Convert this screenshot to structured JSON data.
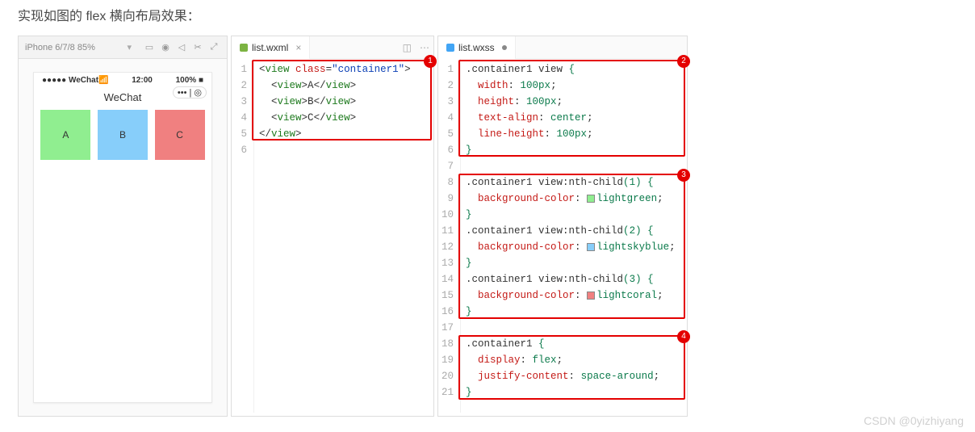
{
  "title": "实现如图的 flex 横向布局效果：",
  "watermark": "CSDN @0yizhiyang",
  "simulator": {
    "device": "iPhone 6/7/8 85%",
    "carrier": "WeChat",
    "time": "12:00",
    "battery": "100%",
    "appTitle": "WeChat",
    "boxes": [
      "A",
      "B",
      "C"
    ]
  },
  "wxml": {
    "filename": "list.wxml",
    "lines": [
      {
        "n": "1",
        "parts": [
          {
            "t": "<",
            "c": "tag"
          },
          {
            "t": "view",
            "c": "tn"
          },
          {
            "t": " ",
            "c": "tag"
          },
          {
            "t": "class",
            "c": "attr"
          },
          {
            "t": "=",
            "c": "tag"
          },
          {
            "t": "\"container1\"",
            "c": "val"
          },
          {
            "t": ">",
            "c": "tag"
          }
        ]
      },
      {
        "n": "2",
        "parts": [
          {
            "t": "  <",
            "c": "tag"
          },
          {
            "t": "view",
            "c": "tn"
          },
          {
            "t": ">",
            "c": "tag"
          },
          {
            "t": "A",
            "c": "tag"
          },
          {
            "t": "</",
            "c": "tag"
          },
          {
            "t": "view",
            "c": "tn"
          },
          {
            "t": ">",
            "c": "tag"
          }
        ]
      },
      {
        "n": "3",
        "parts": [
          {
            "t": "  <",
            "c": "tag"
          },
          {
            "t": "view",
            "c": "tn"
          },
          {
            "t": ">",
            "c": "tag"
          },
          {
            "t": "B",
            "c": "tag"
          },
          {
            "t": "</",
            "c": "tag"
          },
          {
            "t": "view",
            "c": "tn"
          },
          {
            "t": ">",
            "c": "tag"
          }
        ]
      },
      {
        "n": "4",
        "parts": [
          {
            "t": "  <",
            "c": "tag"
          },
          {
            "t": "view",
            "c": "tn"
          },
          {
            "t": ">",
            "c": "tag"
          },
          {
            "t": "C",
            "c": "tag"
          },
          {
            "t": "</",
            "c": "tag"
          },
          {
            "t": "view",
            "c": "tn"
          },
          {
            "t": ">",
            "c": "tag"
          }
        ]
      },
      {
        "n": "5",
        "parts": [
          {
            "t": "</",
            "c": "tag"
          },
          {
            "t": "view",
            "c": "tn"
          },
          {
            "t": ">",
            "c": "tag"
          }
        ]
      },
      {
        "n": "6",
        "parts": []
      }
    ],
    "badge": "1"
  },
  "wxss": {
    "filename": "list.wxss",
    "lines": [
      {
        "n": "1",
        "parts": [
          {
            "t": ".container1 view ",
            "c": "sel"
          },
          {
            "t": "{",
            "c": "brace"
          }
        ]
      },
      {
        "n": "2",
        "parts": [
          {
            "t": "  ",
            "c": ""
          },
          {
            "t": "width",
            "c": "prop"
          },
          {
            "t": ": ",
            "c": ""
          },
          {
            "t": "100px",
            "c": "num"
          },
          {
            "t": ";",
            "c": ""
          }
        ]
      },
      {
        "n": "3",
        "parts": [
          {
            "t": "  ",
            "c": ""
          },
          {
            "t": "height",
            "c": "prop"
          },
          {
            "t": ": ",
            "c": ""
          },
          {
            "t": "100px",
            "c": "num"
          },
          {
            "t": ";",
            "c": ""
          }
        ]
      },
      {
        "n": "4",
        "parts": [
          {
            "t": "  ",
            "c": ""
          },
          {
            "t": "text-align",
            "c": "prop"
          },
          {
            "t": ": ",
            "c": ""
          },
          {
            "t": "center",
            "c": "pval"
          },
          {
            "t": ";",
            "c": ""
          }
        ]
      },
      {
        "n": "5",
        "parts": [
          {
            "t": "  ",
            "c": ""
          },
          {
            "t": "line-height",
            "c": "prop"
          },
          {
            "t": ": ",
            "c": ""
          },
          {
            "t": "100px",
            "c": "num"
          },
          {
            "t": ";",
            "c": ""
          }
        ]
      },
      {
        "n": "6",
        "parts": [
          {
            "t": "}",
            "c": "brace"
          }
        ]
      },
      {
        "n": "7",
        "parts": []
      },
      {
        "n": "8",
        "parts": [
          {
            "t": ".container1 view:nth-child",
            "c": "sel"
          },
          {
            "t": "(",
            "c": "brace"
          },
          {
            "t": "1",
            "c": "num"
          },
          {
            "t": ")",
            "c": "brace"
          },
          {
            "t": " ",
            "c": ""
          },
          {
            "t": "{",
            "c": "brace"
          }
        ]
      },
      {
        "n": "9",
        "parts": [
          {
            "t": "  ",
            "c": ""
          },
          {
            "t": "background-color",
            "c": "prop"
          },
          {
            "t": ": ",
            "c": ""
          },
          {
            "sw": "lightgreen"
          },
          {
            "t": "lightgreen",
            "c": "pval"
          },
          {
            "t": ";",
            "c": ""
          }
        ]
      },
      {
        "n": "10",
        "parts": [
          {
            "t": "}",
            "c": "brace"
          }
        ]
      },
      {
        "n": "11",
        "parts": [
          {
            "t": ".container1 view:nth-child",
            "c": "sel"
          },
          {
            "t": "(",
            "c": "brace"
          },
          {
            "t": "2",
            "c": "num"
          },
          {
            "t": ")",
            "c": "brace"
          },
          {
            "t": " ",
            "c": ""
          },
          {
            "t": "{",
            "c": "brace"
          }
        ]
      },
      {
        "n": "12",
        "parts": [
          {
            "t": "  ",
            "c": ""
          },
          {
            "t": "background-color",
            "c": "prop"
          },
          {
            "t": ": ",
            "c": ""
          },
          {
            "sw": "lightskyblue"
          },
          {
            "t": "lightskyblue",
            "c": "pval"
          },
          {
            "t": ";",
            "c": ""
          }
        ]
      },
      {
        "n": "13",
        "parts": [
          {
            "t": "}",
            "c": "brace"
          }
        ]
      },
      {
        "n": "14",
        "parts": [
          {
            "t": ".container1 view:nth-child",
            "c": "sel"
          },
          {
            "t": "(",
            "c": "brace"
          },
          {
            "t": "3",
            "c": "num"
          },
          {
            "t": ")",
            "c": "brace"
          },
          {
            "t": " ",
            "c": ""
          },
          {
            "t": "{",
            "c": "brace"
          }
        ]
      },
      {
        "n": "15",
        "parts": [
          {
            "t": "  ",
            "c": ""
          },
          {
            "t": "background-color",
            "c": "prop"
          },
          {
            "t": ": ",
            "c": ""
          },
          {
            "sw": "lightcoral"
          },
          {
            "t": "lightcoral",
            "c": "pval"
          },
          {
            "t": ";",
            "c": ""
          }
        ]
      },
      {
        "n": "16",
        "parts": [
          {
            "t": "}",
            "c": "brace"
          }
        ]
      },
      {
        "n": "17",
        "parts": []
      },
      {
        "n": "18",
        "parts": [
          {
            "t": ".container1 ",
            "c": "sel"
          },
          {
            "t": "{",
            "c": "brace"
          }
        ]
      },
      {
        "n": "19",
        "parts": [
          {
            "t": "  ",
            "c": ""
          },
          {
            "t": "display",
            "c": "prop"
          },
          {
            "t": ": ",
            "c": ""
          },
          {
            "t": "flex",
            "c": "pval"
          },
          {
            "t": ";",
            "c": ""
          }
        ]
      },
      {
        "n": "20",
        "parts": [
          {
            "t": "  ",
            "c": ""
          },
          {
            "t": "justify-content",
            "c": "prop"
          },
          {
            "t": ": ",
            "c": ""
          },
          {
            "t": "space-around",
            "c": "pval"
          },
          {
            "t": ";",
            "c": ""
          }
        ]
      },
      {
        "n": "21",
        "parts": [
          {
            "t": "}",
            "c": "brace"
          }
        ]
      }
    ],
    "badges": {
      "b2": "2",
      "b3": "3",
      "b4": "4"
    }
  }
}
